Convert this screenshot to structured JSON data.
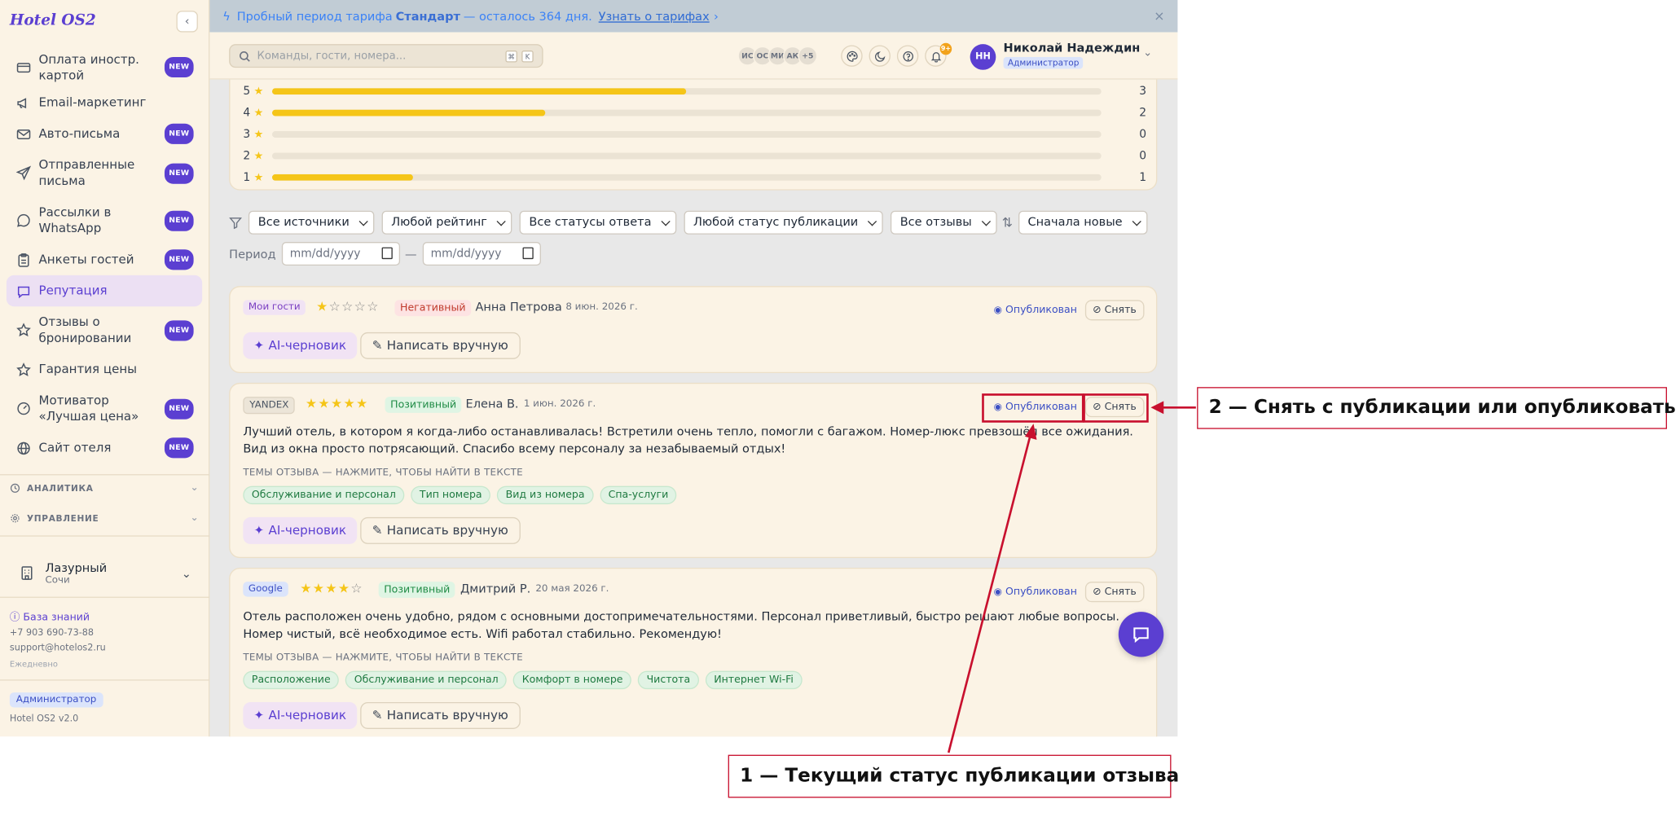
{
  "app": {
    "logo": "Hotel OS2",
    "collapse_icon": "‹"
  },
  "sidebar": {
    "items": [
      {
        "label": "Оплата иностр. картой",
        "badge": "NEW",
        "icon": "credit-card-icon"
      },
      {
        "label": "Email-маркетинг",
        "badge": "",
        "icon": "megaphone-icon"
      },
      {
        "label": "Авто-письма",
        "badge": "NEW",
        "icon": "mail-icon"
      },
      {
        "label": "Отправленные письма",
        "badge": "NEW",
        "icon": "send-icon"
      },
      {
        "label": "Рассылки в WhatsApp",
        "badge": "NEW",
        "icon": "chat-bubble-icon"
      },
      {
        "label": "Анкеты гостей",
        "badge": "NEW",
        "icon": "clipboard-icon"
      },
      {
        "label": "Репутация",
        "badge": "",
        "icon": "message-square-icon",
        "active": true
      },
      {
        "label": "Отзывы о бронировании",
        "badge": "NEW",
        "icon": "star-icon"
      },
      {
        "label": "Гарантия цены",
        "badge": "",
        "icon": "star-outline-icon"
      },
      {
        "label": "Мотиватор «Лучшая цена»",
        "badge": "NEW",
        "icon": "gauge-icon"
      },
      {
        "label": "Сайт отеля",
        "badge": "NEW",
        "icon": "globe-icon"
      }
    ],
    "sections": {
      "analytics": "АНАЛИТИКА",
      "management": "УПРАВЛЕНИЕ"
    },
    "hotel": {
      "name": "Лазурный",
      "city": "Сочи"
    },
    "kb_link": "База знаний",
    "phone": "+7 903 690-73-88",
    "email": "support@hotelos2.ru",
    "schedule": "Ежедневно",
    "role_badge": "Администратор",
    "version": "Hotel OS2 v2.0"
  },
  "banner": {
    "text_pre": "Пробный период тарифа",
    "plan": "Стандарт",
    "text_post": "— осталось 364 дня.",
    "link": "Узнать о тарифах",
    "link_arrow": "›",
    "close": "×"
  },
  "header": {
    "search_placeholder": "Команды, гости, номера...",
    "kbd1": "⌘",
    "kbd2": "K",
    "avatars": [
      "ИС",
      "ОС",
      "МИ",
      "АК",
      "+5"
    ],
    "bell_count": "9+",
    "user_initials": "НН",
    "user_name": "Николай Надеждин",
    "user_role": "Администратор"
  },
  "ratings": {
    "rows": [
      {
        "stars": "5",
        "count": "3",
        "share": 0.5
      },
      {
        "stars": "4",
        "count": "2",
        "share": 0.33
      },
      {
        "stars": "3",
        "count": "0",
        "share": 0
      },
      {
        "stars": "2",
        "count": "0",
        "share": 0
      },
      {
        "stars": "1",
        "count": "1",
        "share": 0.17
      }
    ]
  },
  "filters": {
    "source": "Все источники",
    "rating": "Любой рейтинг",
    "response": "Все статусы ответа",
    "publication": "Любой статус публикации",
    "reviews": "Все отзывы",
    "sort": "Сначала новые",
    "period_label": "Период",
    "date_placeholder": "mm/dd/yyyy",
    "dash": "—"
  },
  "reviews": [
    {
      "source": "Мои гости",
      "rating": 1,
      "sentiment": "Негативный",
      "author": "Анна Петрова",
      "date": "8 июн. 2026 г.",
      "status": "Опубликован",
      "action": "Снять",
      "text": "",
      "topics_header": "",
      "topics": []
    },
    {
      "source": "YANDEX",
      "rating": 5,
      "sentiment": "Позитивный",
      "author": "Елена В.",
      "date": "1 июн. 2026 г.",
      "status": "Опубликован",
      "action": "Снять",
      "text": "Лучший отель, в котором я когда-либо останавливалась! Встретили очень тепло, помогли с багажом. Номер-люкс превзошёл все ожидания. Вид из окна просто потрясающий. Спасибо всему персоналу за незабываемый отдых!",
      "topics_header": "ТЕМЫ ОТЗЫВА — НАЖМИТЕ, ЧТОБЫ НАЙТИ В ТЕКСТЕ",
      "topics": [
        "Обслуживание и персонал",
        "Тип номера",
        "Вид из номера",
        "Спа-услуги"
      ]
    },
    {
      "source": "Google",
      "rating": 4,
      "sentiment": "Позитивный",
      "author": "Дмитрий Р.",
      "date": "20 мая 2026 г.",
      "status": "Опубликован",
      "action": "Снять",
      "text": "Отель расположен очень удобно, рядом с основными достопримечательностями. Персонал приветливый, быстро решают любые вопросы. Номер чистый, всё необходимое есть. Wifi работал стабильно. Рекомендую!",
      "topics_header": "ТЕМЫ ОТЗЫВА — НАЖМИТЕ, ЧТОБЫ НАЙТИ В ТЕКСТЕ",
      "topics": [
        "Расположение",
        "Обслуживание и персонал",
        "Комфорт в номере",
        "Чистота",
        "Интернет Wi-Fi"
      ]
    }
  ],
  "review_actions": {
    "ai": "AI-черновик",
    "manual": "Написать вручную"
  },
  "annotations": {
    "callout1": "1 — Текущий статус публикации отзыва",
    "callout2": "2 — Снять с публикации или опубликовать"
  },
  "colors": {
    "accent": "#5b3fd1",
    "star": "#f5c518",
    "annotation": "#c8102e"
  }
}
